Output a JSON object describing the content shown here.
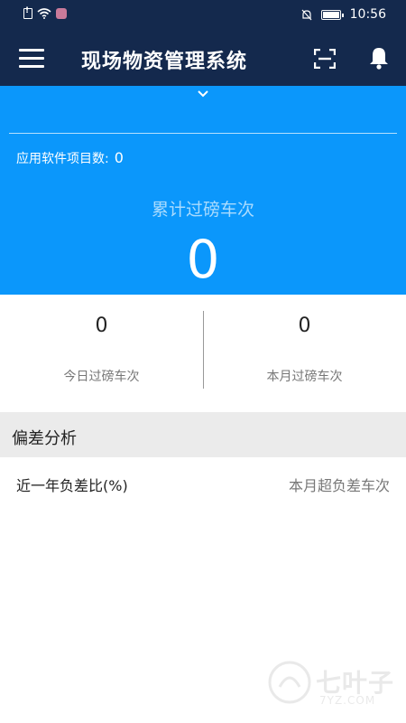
{
  "status_bar": {
    "time": "10:56"
  },
  "header": {
    "title": "现场物资管理系统"
  },
  "summary": {
    "project_count_label": "应用软件项目数:",
    "project_count_value": "0",
    "total_label": "累计过磅车次",
    "total_value": "0"
  },
  "stats": {
    "today": {
      "value": "0",
      "label": "今日过磅车次"
    },
    "month": {
      "value": "0",
      "label": "本月过磅车次"
    }
  },
  "deviation": {
    "title": "偏差分析",
    "left_link": "近一年负差比(%)",
    "right_link": "本月超负差车次"
  },
  "watermark": {
    "text": "七叶子",
    "sub": "7YZ.COM"
  },
  "colors": {
    "navy": "#14294d",
    "accent_blue": "#0b97fb",
    "section_bg": "#ebebeb"
  }
}
